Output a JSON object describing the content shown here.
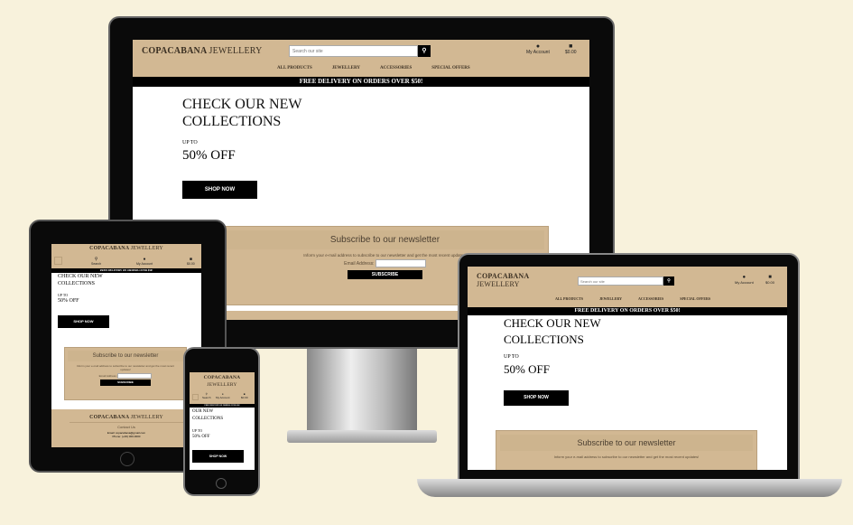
{
  "site": {
    "logo_bold": "COPACABANA",
    "logo_light": "JEWELLERY",
    "search_placeholder": "Search our site",
    "search_label": "Search",
    "account": "My Account",
    "bag": "$0.00",
    "nav": [
      "ALL PRODUCTS",
      "JEWELLERY",
      "ACCESSORIES",
      "SPECIAL OFFERS"
    ],
    "banner": "FREE DELIVERY ON ORDERS OVER $50!",
    "hero_line1": "CHECK OUR NEW",
    "hero_line2": "COLLECTIONS",
    "hero_phone_line1": "OUR NEW",
    "upto": "UP TO",
    "off": "50% OFF",
    "shop": "SHOP NOW",
    "newsletter_title": "Subscribe to our newsletter",
    "newsletter_text": "Inform your e-mail address to subscribe to our newsletter and get the most recent updates!",
    "email_label": "Email Address:",
    "subscribe": "SUBSCRIBE",
    "footer_contact": "Contact Us",
    "footer_email": "Email: copacabana@gmail.com",
    "footer_phone": "Phone: (+00) 000-0000"
  },
  "colors": {
    "tan": "#d2b893",
    "background": "#f8f2dc"
  }
}
